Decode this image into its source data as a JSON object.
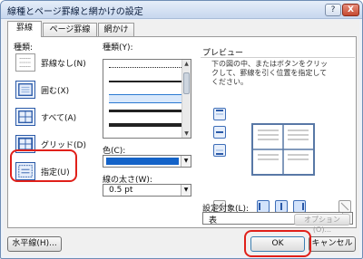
{
  "window": {
    "title": "線種とページ罫線と網かけの設定",
    "help": "?",
    "close": "X"
  },
  "tabs": [
    {
      "label": "罫線",
      "active": true
    },
    {
      "label": "ページ罫線",
      "active": false
    },
    {
      "label": "網かけ",
      "active": false
    }
  ],
  "presets": {
    "heading": "種類:",
    "items": [
      {
        "label": "罫線なし(N)"
      },
      {
        "label": "囲む(X)"
      },
      {
        "label": "すべて(A)"
      },
      {
        "label": "グリッド(D)"
      },
      {
        "label": "指定(U)"
      }
    ]
  },
  "style": {
    "heading": "種類(Y):"
  },
  "color": {
    "heading": "色(C):",
    "value": "#1463c8"
  },
  "width": {
    "heading": "線の太さ(W):",
    "value": "0.5 pt"
  },
  "preview": {
    "heading": "プレビュー",
    "instruction": "下の図の中、またはボタンをクリックして、罫線を引く位置を指定してください。"
  },
  "apply_to": {
    "heading": "設定対象(L):",
    "value": "表"
  },
  "buttons": {
    "options": "オプション(O)...",
    "horizontal_line": "水平線(H)...",
    "ok": "OK",
    "cancel": "キャンセル"
  }
}
